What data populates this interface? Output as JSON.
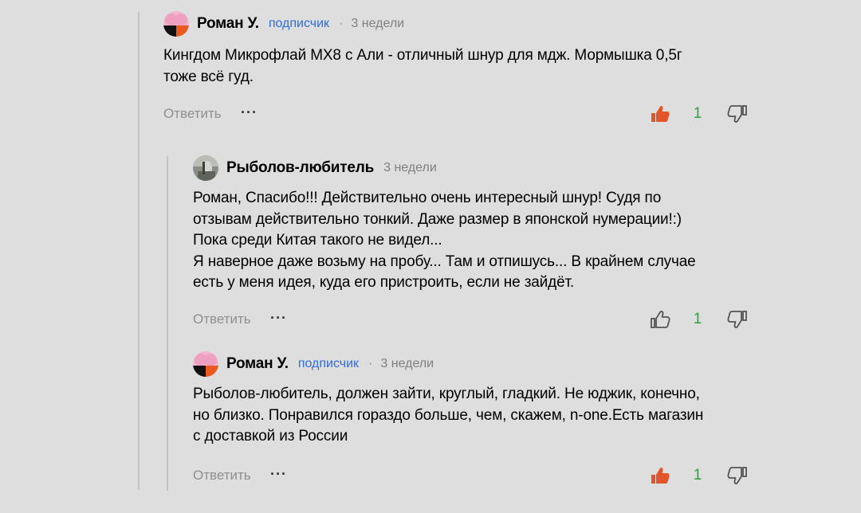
{
  "colors": {
    "background": "#dedede",
    "badge_blue": "#2f6dd9",
    "like_active": "#e2542a",
    "count_green": "#2aa33a",
    "meta_gray": "#7f7f7f"
  },
  "comments": [
    {
      "author": "Роман У.",
      "badge": "подписчик",
      "separator": "·",
      "time": "3 недели",
      "text_lines": [
        "Кингдом Микрофлай МХ8 с Али - отличный шнур для мдж. Мормышка 0,5г",
        "тоже всё гуд."
      ],
      "reply_label": "Ответить",
      "more_label": "···",
      "likes": "1",
      "liked": true,
      "avatar_icon": "user-avatar-icon"
    },
    {
      "author": "Рыболов-любитель",
      "time": "3 недели",
      "text_lines": [
        "Роман, Спасибо!!! Действительно очень интересный шнур! Судя по",
        "отзывам действительно тонкий. Даже размер в японской нумерации!:)",
        "Пока среди Китая такого не видел...",
        "Я наверное даже возьму на пробу... Там и отпишусь... В крайнем случае",
        "есть у меня идея, куда его пристроить, если не зайдёт."
      ],
      "reply_label": "Ответить",
      "more_label": "···",
      "likes": "1",
      "liked": false,
      "avatar_icon": "user-photo-avatar-icon"
    },
    {
      "author": "Роман У.",
      "badge": "подписчик",
      "separator": "·",
      "time": "3 недели",
      "text_lines": [
        "Рыболов-любитель, должен зайти, круглый, гладкий. Не юджик, конечно,",
        "но близко. Понравился гораздо больше, чем, скажем, n-one.Есть магазин",
        "с доставкой из России"
      ],
      "reply_label": "Ответить",
      "more_label": "···",
      "likes": "1",
      "liked": true,
      "avatar_icon": "user-avatar-icon"
    }
  ]
}
